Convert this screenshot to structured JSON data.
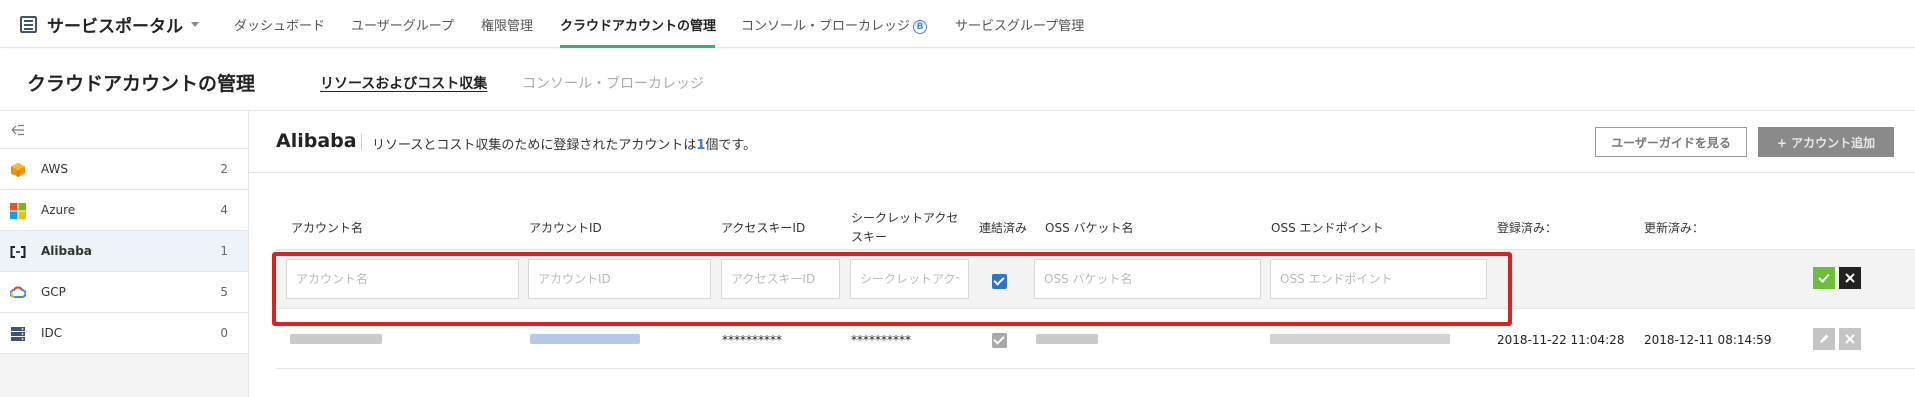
{
  "nav": {
    "brand": "サービスポータル",
    "items": [
      {
        "label": "ダッシュボード"
      },
      {
        "label": "ユーザーグループ"
      },
      {
        "label": "権限管理"
      },
      {
        "label": "クラウドアカウントの管理",
        "active": true
      },
      {
        "label": "コンソール・ブローカレッジ",
        "badge": "B"
      },
      {
        "label": "サービスグループ管理"
      }
    ],
    "accent_color": "#2bb673"
  },
  "page": {
    "title": "クラウドアカウントの管理",
    "tabs": [
      {
        "label": "リソースおよびコスト収集",
        "active": true
      },
      {
        "label": "コンソール・ブローカレッジ",
        "active": false
      }
    ]
  },
  "sidebar": {
    "collapse_icon": "collapse-left-icon",
    "items": [
      {
        "label": "AWS",
        "count": "2",
        "icon": "aws-icon"
      },
      {
        "label": "Azure",
        "count": "4",
        "icon": "azure-icon"
      },
      {
        "label": "Alibaba",
        "count": "1",
        "icon": "alibaba-icon",
        "selected": true
      },
      {
        "label": "GCP",
        "count": "5",
        "icon": "gcp-icon"
      },
      {
        "label": "IDC",
        "count": "0",
        "icon": "server-icon"
      }
    ]
  },
  "main": {
    "provider": "Alibaba",
    "desc_before": "リソースとコスト収集のために登録されたアカウントは",
    "desc_count": "1",
    "desc_after": "個です。",
    "guide_button": "ユーザーガイドを見る",
    "add_button": "+ アカウント追加",
    "columns": {
      "account_name": "アカウント名",
      "account_id": "アカウントID",
      "access_key": "アクセスキーID",
      "secret_key_1": "シークレットアクセ",
      "secret_key_2": "スキー",
      "linked": "連結済み",
      "oss_bucket": "OSS バケット名",
      "oss_endpoint": "OSS エンドポイント",
      "registered": "登録済み：",
      "updated": "更新済み："
    },
    "new_row": {
      "placeholders": {
        "account_name": "アカウント名",
        "account_id": "アカウントID",
        "access_key": "アクセスキーID",
        "secret_key": "シークレットアクセスキー",
        "oss_bucket": "OSS バケット名",
        "oss_endpoint": "OSS エンドポイント"
      },
      "linked_checked": true
    },
    "rows": [
      {
        "access_key": "**********",
        "secret_key": "**********",
        "linked": true,
        "registered": "2018-11-22 11:04:28",
        "updated": "2018-12-11 08:14:59"
      }
    ]
  },
  "colors": {
    "confirm": "#6cbf3b",
    "cancel": "#222222",
    "highlight": "#e02020",
    "link": "#2b7fd4"
  }
}
